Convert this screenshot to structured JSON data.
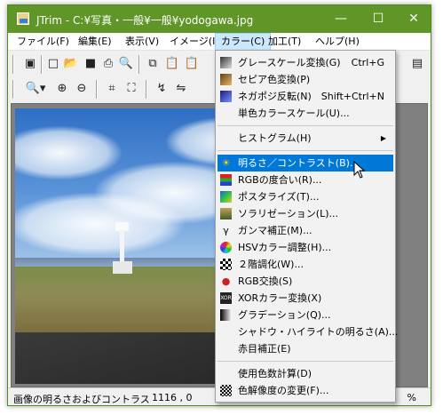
{
  "window": {
    "title": "JTrim - C:¥写真・一般¥一般¥yodogawa.jpg",
    "controls": {
      "minimize": "—",
      "maximize": "☐",
      "close": "✕"
    }
  },
  "menubar": [
    "ファイル(F)",
    "編集(E)",
    "表示(V)",
    "イメージ(I)",
    "カラー(C)",
    "加工(T)",
    "ヘルプ(H)"
  ],
  "toolbar_icons": [
    "new-window-icon",
    "new-file-icon",
    "open-folder-icon",
    "save-icon",
    "print-icon",
    "print-preview-icon",
    "copy-icon",
    "paste-icon",
    "paste-new-icon",
    "zoom-dropdown-icon",
    "zoom-in-icon",
    "zoom-out-icon",
    "crop-icon",
    "trim-icon",
    "rotate-icon",
    "flip-icon"
  ],
  "color_menu": {
    "items": [
      {
        "label": "グレースケール変換(G)",
        "shortcut": "Ctrl+G",
        "icon": "grayscale-icon"
      },
      {
        "label": "セピア色変換(P)",
        "shortcut": "",
        "icon": "sepia-icon"
      },
      {
        "label": "ネガポジ反転(N)",
        "shortcut": "Shift+Ctrl+N",
        "icon": "negative-icon"
      },
      {
        "label": "単色カラースケール(U)...",
        "shortcut": "",
        "icon": ""
      },
      {
        "label": "ヒストグラム(H)",
        "shortcut": "",
        "icon": ""
      },
      {
        "label": "明るさ／コントラスト(B)...",
        "shortcut": "",
        "icon": "brightness-icon"
      },
      {
        "label": "RGBの度合い(R)...",
        "shortcut": "",
        "icon": "rgb-degree-icon"
      },
      {
        "label": "ポスタライズ(T)...",
        "shortcut": "",
        "icon": "posterize-icon"
      },
      {
        "label": "ソラリゼーション(L)...",
        "shortcut": "",
        "icon": "solarize-icon"
      },
      {
        "label": "ガンマ補正(M)...",
        "shortcut": "",
        "icon": "gamma-icon"
      },
      {
        "label": "HSVカラー調整(H)...",
        "shortcut": "",
        "icon": "hsv-icon"
      },
      {
        "label": "２階調化(W)...",
        "shortcut": "",
        "icon": "two-tone-icon"
      },
      {
        "label": "RGB交換(S)",
        "shortcut": "",
        "icon": "rgb-swap-icon"
      },
      {
        "label": "XORカラー変換(X)",
        "shortcut": "",
        "icon": "xor-icon"
      },
      {
        "label": "グラデーション(Q)...",
        "shortcut": "",
        "icon": "gradation-icon"
      },
      {
        "label": "シャドウ・ハイライトの明るさ(A)...",
        "shortcut": "",
        "icon": ""
      },
      {
        "label": "赤目補正(E)",
        "shortcut": "",
        "icon": ""
      },
      {
        "label": "使用色数計算(D)",
        "shortcut": "",
        "icon": ""
      },
      {
        "label": "色解像度の変更(F)...",
        "shortcut": "",
        "icon": "color-depth-icon"
      }
    ],
    "highlighted_index": 5,
    "submenu_index": 4
  },
  "status": {
    "message": "画像の明るさおよびコントラストを",
    "coords": "1116 , 0",
    "zoom": "%"
  },
  "colors": {
    "titlebar": "#5f9627",
    "highlight": "#0078d7",
    "menu_active": "#cce8ff"
  }
}
